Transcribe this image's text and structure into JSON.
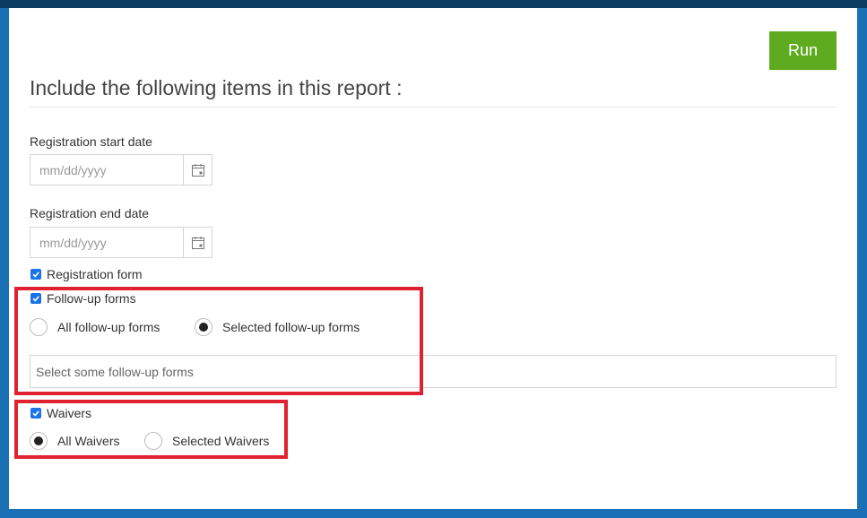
{
  "header": {
    "run_label": "Run",
    "title": "Include the following items in this report :"
  },
  "registration_start": {
    "label": "Registration start date",
    "placeholder": "mm/dd/yyyy",
    "icon": "calendar-icon"
  },
  "registration_end": {
    "label": "Registration end date",
    "placeholder": "mm/dd/yyyy",
    "icon": "calendar-icon"
  },
  "registration_form": {
    "label": "Registration form",
    "checked": true
  },
  "followup": {
    "label": "Follow-up forms",
    "checked": true,
    "options": [
      {
        "label": "All follow-up forms",
        "selected": false
      },
      {
        "label": "Selected follow-up forms",
        "selected": true
      }
    ],
    "select_placeholder": "Select some follow-up forms"
  },
  "waivers": {
    "label": "Waivers",
    "checked": true,
    "options": [
      {
        "label": "All Waivers",
        "selected": true
      },
      {
        "label": "Selected Waivers",
        "selected": false
      }
    ]
  },
  "colors": {
    "run_button": "#5eab1f",
    "checkbox": "#1a73e8",
    "highlight": "#e0212f",
    "frame": "#1a6fb5"
  }
}
